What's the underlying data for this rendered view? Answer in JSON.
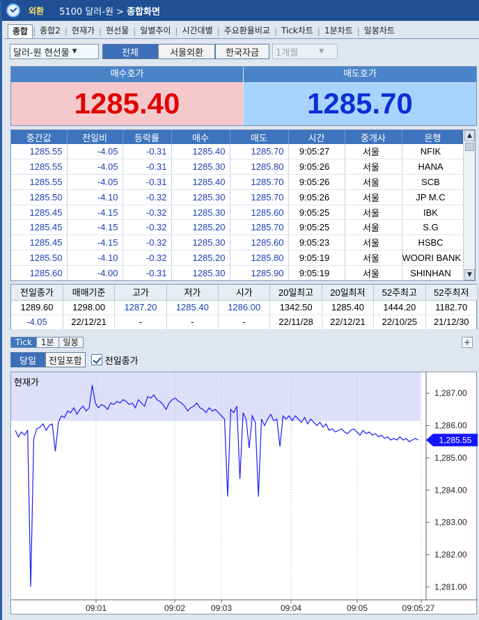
{
  "titlebar": {
    "section": "외환",
    "code": "5100",
    "title_prefix": "달러-원 > ",
    "title_main": "종합화면"
  },
  "tabs": [
    {
      "label": "종합",
      "active": true
    },
    {
      "label": "종합2"
    },
    {
      "label": "현재가"
    },
    {
      "label": "현선물"
    },
    {
      "label": "일별추이"
    },
    {
      "label": "시간대별"
    },
    {
      "label": "주요환율비교"
    },
    {
      "label": "Tick차트"
    },
    {
      "label": "1분차트"
    },
    {
      "label": "일봉차트"
    }
  ],
  "filters": {
    "product_select": "달러-원 현선물",
    "segments": [
      "전체",
      "서울외환",
      "한국자금"
    ],
    "period_select": "1개월"
  },
  "quote": {
    "bid_label": "매수호가",
    "bid_price": "1285.40",
    "ask_label": "매도호가",
    "ask_price": "1285.70"
  },
  "trades": {
    "columns": [
      "중간값",
      "전일비",
      "등락률",
      "매수",
      "매도",
      "시간",
      "중개사",
      "은행"
    ],
    "rows": [
      [
        "1285.55",
        "-4.05",
        "-0.31",
        "1285.40",
        "1285.70",
        "9:05:27",
        "서울",
        "NFIK"
      ],
      [
        "1285.55",
        "-4.05",
        "-0.31",
        "1285.30",
        "1285.80",
        "9:05:26",
        "서울",
        "HANA"
      ],
      [
        "1285.55",
        "-4.05",
        "-0.31",
        "1285.40",
        "1285.70",
        "9:05:26",
        "서울",
        "SCB"
      ],
      [
        "1285.50",
        "-4.10",
        "-0.32",
        "1285.30",
        "1285.70",
        "9:05:26",
        "서울",
        "JP M.C"
      ],
      [
        "1285.45",
        "-4.15",
        "-0.32",
        "1285.30",
        "1285.60",
        "9:05:25",
        "서울",
        "IBK"
      ],
      [
        "1285.45",
        "-4.15",
        "-0.32",
        "1285.20",
        "1285.70",
        "9:05:25",
        "서울",
        "S.G"
      ],
      [
        "1285.45",
        "-4.15",
        "-0.32",
        "1285.30",
        "1285.60",
        "9:05:23",
        "서울",
        "HSBC"
      ],
      [
        "1285.50",
        "-4.10",
        "-0.32",
        "1285.20",
        "1285.80",
        "9:05:19",
        "서울",
        "WOORI BANK"
      ],
      [
        "1285.60",
        "-4.00",
        "-0.31",
        "1285.30",
        "1285.90",
        "9:05:19",
        "서울",
        "SHINHAN"
      ]
    ]
  },
  "summary": {
    "columns": [
      "전일종가",
      "매매기준",
      "고가",
      "저가",
      "시가",
      "20일최고",
      "20일최저",
      "52주최고",
      "52주최저"
    ],
    "row1": [
      "1289.60",
      "1298.00",
      "1287.20",
      "1285.40",
      "1286.00",
      "1342.50",
      "1285.40",
      "1444.20",
      "1182.70"
    ],
    "row2": [
      "-4.05",
      "22/12/21",
      "-",
      "-",
      "-",
      "22/11/28",
      "22/12/21",
      "22/10/25",
      "21/12/30"
    ]
  },
  "chart_tabs": [
    "Tick",
    "1분",
    "일봉"
  ],
  "chart_controls": {
    "today": "당일",
    "include_prev": "전일포함",
    "prev_close_label": "전일종가",
    "prev_close_checked": true,
    "plus": "+"
  },
  "chart_data": {
    "type": "line",
    "title": "현재가",
    "x_labels": [
      "09:01",
      "09:02",
      "09:03",
      "09:04",
      "09:05",
      "09:05:27"
    ],
    "ylim": [
      1280.6,
      1287.65
    ],
    "y_ticks": [
      "1,287.00",
      "1,286.00",
      "1,285.00",
      "1,284.00",
      "1,283.00",
      "1,282.00",
      "1,281.00"
    ],
    "current_value_label": "1,285.55",
    "series": [
      {
        "color": "#1a1aff",
        "values": [
          1285.85,
          1285.65,
          1285.8,
          1285.7,
          1285.85,
          1281.0,
          1285.6,
          1285.9,
          1285.95,
          1286.05,
          1285.85,
          1286.0,
          1286.05,
          1285.2,
          1286.1,
          1286.3,
          1286.25,
          1286.45,
          1286.4,
          1286.55,
          1286.35,
          1286.5,
          1286.6,
          1286.45,
          1286.55,
          1287.25,
          1286.7,
          1286.55,
          1286.65,
          1286.6,
          1286.5,
          1286.7,
          1286.65,
          1286.75,
          1286.7,
          1286.8,
          1286.75,
          1286.65,
          1286.7,
          1286.55,
          1286.8,
          1286.7,
          1286.6,
          1286.9,
          1286.85,
          1286.95,
          1286.8,
          1286.75,
          1286.65,
          1286.5,
          1286.7,
          1286.8,
          1286.85,
          1286.75,
          1286.7,
          1286.6,
          1286.45,
          1286.55,
          1286.6,
          1286.7,
          1286.55,
          1286.5,
          1286.4,
          1286.55,
          1286.45,
          1286.5,
          1286.4,
          1286.3,
          1286.2,
          1283.8,
          1286.5,
          1286.4,
          1286.6,
          1284.35,
          1286.4,
          1286.2,
          1285.3,
          1286.3,
          1286.1,
          1283.8,
          1286.2,
          1286.0,
          1286.2,
          1286.35,
          1286.15,
          1286.2,
          1285.35,
          1286.3,
          1286.2,
          1286.3,
          1286.15,
          1286.3,
          1286.2,
          1286.1,
          1286.25,
          1286.05,
          1286.2,
          1286.1,
          1286.0,
          1286.1,
          1285.95,
          1286.05,
          1285.85,
          1285.9,
          1285.8,
          1285.85,
          1285.9,
          1285.8,
          1285.75,
          1285.85,
          1285.9,
          1285.8,
          1285.7,
          1285.85,
          1285.75,
          1285.8,
          1285.7,
          1285.75,
          1285.65,
          1285.7,
          1285.6,
          1285.65,
          1285.55,
          1285.6,
          1285.55,
          1285.65,
          1285.55,
          1285.6,
          1285.5,
          1285.55,
          1285.6,
          1285.55
        ]
      }
    ]
  }
}
